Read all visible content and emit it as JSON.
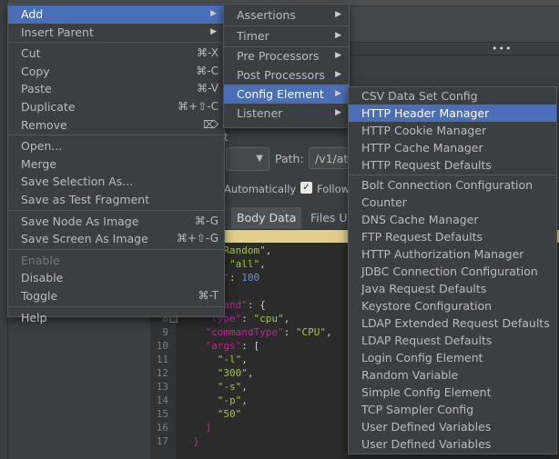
{
  "background": {
    "section_label": "t",
    "path_label": "Path:",
    "path_value": "/v1/att",
    "automatically_text": "Automatically",
    "follow_text": "Follow",
    "tabs": [
      "Body Data",
      "Files U"
    ],
    "code_lines": [
      {
        "n": "",
        "html": "  <span class=\"k\">t\"</span><span class=\"p\">: {</span>"
      },
      {
        "n": "",
        "html": "  <span class=\"k\">e\"</span><span class=\"p\">: </span><span class=\"s\">\"Random\"</span><span class=\"p\">,</span>"
      },
      {
        "n": "",
        "html": "  <span class=\"k\">sts\"</span><span class=\"p\">: </span><span class=\"s\">\"all\"</span><span class=\"p\">,</span>"
      },
      {
        "n": "",
        "html": "  <span class=\"k\">rcent\"</span><span class=\"p\">: </span><span class=\"n\">100</span>"
      },
      {
        "n": "",
        "html": ""
      },
      {
        "n": "7",
        "html": "  <span class=\"k\">\"command\"</span><span class=\"p\">: {</span>"
      },
      {
        "n": "8",
        "html": "    <span class=\"k\">\"type\"</span><span class=\"p\">: </span><span class=\"s\">\"cpu\"</span><span class=\"p\">,</span>"
      },
      {
        "n": "9",
        "html": "    <span class=\"k\">\"commandType\"</span><span class=\"p\">: </span><span class=\"s\">\"CPU\"</span><span class=\"p\">,</span>"
      },
      {
        "n": "10",
        "html": "    <span class=\"k\">\"args\"</span><span class=\"p\">: [</span>"
      },
      {
        "n": "11",
        "html": "      <span class=\"s\">\"-l\"</span><span class=\"p\">,</span>"
      },
      {
        "n": "12",
        "html": "      <span class=\"s\">\"300\"</span><span class=\"p\">,</span>"
      },
      {
        "n": "13",
        "html": "      <span class=\"s\">\"-s\"</span><span class=\"p\">,</span>"
      },
      {
        "n": "14",
        "html": "      <span class=\"s\">\"-p\"</span><span class=\"p\">,</span>"
      },
      {
        "n": "15",
        "html": "      <span class=\"s\">\"50\"</span>"
      },
      {
        "n": "16",
        "html": "    <span class=\"r\">]</span>"
      },
      {
        "n": "17",
        "html": "  <span class=\"r\">}</span>"
      }
    ]
  },
  "main_menu": {
    "items": [
      {
        "label": "Add",
        "selected": true,
        "submenu": true
      },
      {
        "label": "Insert Parent",
        "submenu": true
      },
      {
        "sep": true
      },
      {
        "label": "Cut",
        "shortcut": "⌘-X"
      },
      {
        "label": "Copy",
        "shortcut": "⌘-C"
      },
      {
        "label": "Paste",
        "shortcut": "⌘-V"
      },
      {
        "label": "Duplicate",
        "shortcut": "⌘+⇧-C"
      },
      {
        "label": "Remove",
        "shortcut": "⌦"
      },
      {
        "sep": true
      },
      {
        "label": "Open..."
      },
      {
        "label": "Merge"
      },
      {
        "label": "Save Selection As..."
      },
      {
        "label": "Save as Test Fragment"
      },
      {
        "sep": true
      },
      {
        "label": "Save Node As Image",
        "shortcut": "⌘-G"
      },
      {
        "label": "Save Screen As Image",
        "shortcut": "⌘+⇧-G"
      },
      {
        "sep": true
      },
      {
        "label": "Enable",
        "disabled": true
      },
      {
        "label": "Disable"
      },
      {
        "label": "Toggle",
        "shortcut": "⌘-T"
      },
      {
        "sep": true
      },
      {
        "label": "Help"
      }
    ]
  },
  "add_submenu": {
    "items": [
      {
        "label": "Assertions",
        "submenu": true
      },
      {
        "sep": true
      },
      {
        "label": "Timer",
        "submenu": true
      },
      {
        "sep": true
      },
      {
        "label": "Pre Processors",
        "submenu": true
      },
      {
        "label": "Post Processors",
        "submenu": true
      },
      {
        "label": "Config Element",
        "submenu": true,
        "selected": true
      },
      {
        "label": "Listener",
        "submenu": true
      }
    ]
  },
  "config_submenu": {
    "items": [
      {
        "label": "CSV Data Set Config"
      },
      {
        "label": "HTTP Header Manager",
        "selected": true
      },
      {
        "label": "HTTP Cookie Manager"
      },
      {
        "label": "HTTP Cache Manager"
      },
      {
        "label": "HTTP Request Defaults"
      },
      {
        "sep": true
      },
      {
        "label": "Bolt Connection Configuration"
      },
      {
        "label": "Counter"
      },
      {
        "label": "DNS Cache Manager"
      },
      {
        "label": "FTP Request Defaults"
      },
      {
        "label": "HTTP Authorization Manager"
      },
      {
        "label": "JDBC Connection Configuration"
      },
      {
        "label": "Java Request Defaults"
      },
      {
        "label": "Keystore Configuration"
      },
      {
        "label": "LDAP Extended Request Defaults"
      },
      {
        "label": "LDAP Request Defaults"
      },
      {
        "label": "Login Config Element"
      },
      {
        "label": "Random Variable"
      },
      {
        "label": "Simple Config Element"
      },
      {
        "label": "TCP Sampler Config"
      },
      {
        "label": "User Defined Variables"
      },
      {
        "label": "User Defined Variables"
      }
    ]
  },
  "colors": {
    "selection": "#4a6eb8",
    "menu_bg": "#3c3f41",
    "highlight_line": "#ffeb9d"
  }
}
